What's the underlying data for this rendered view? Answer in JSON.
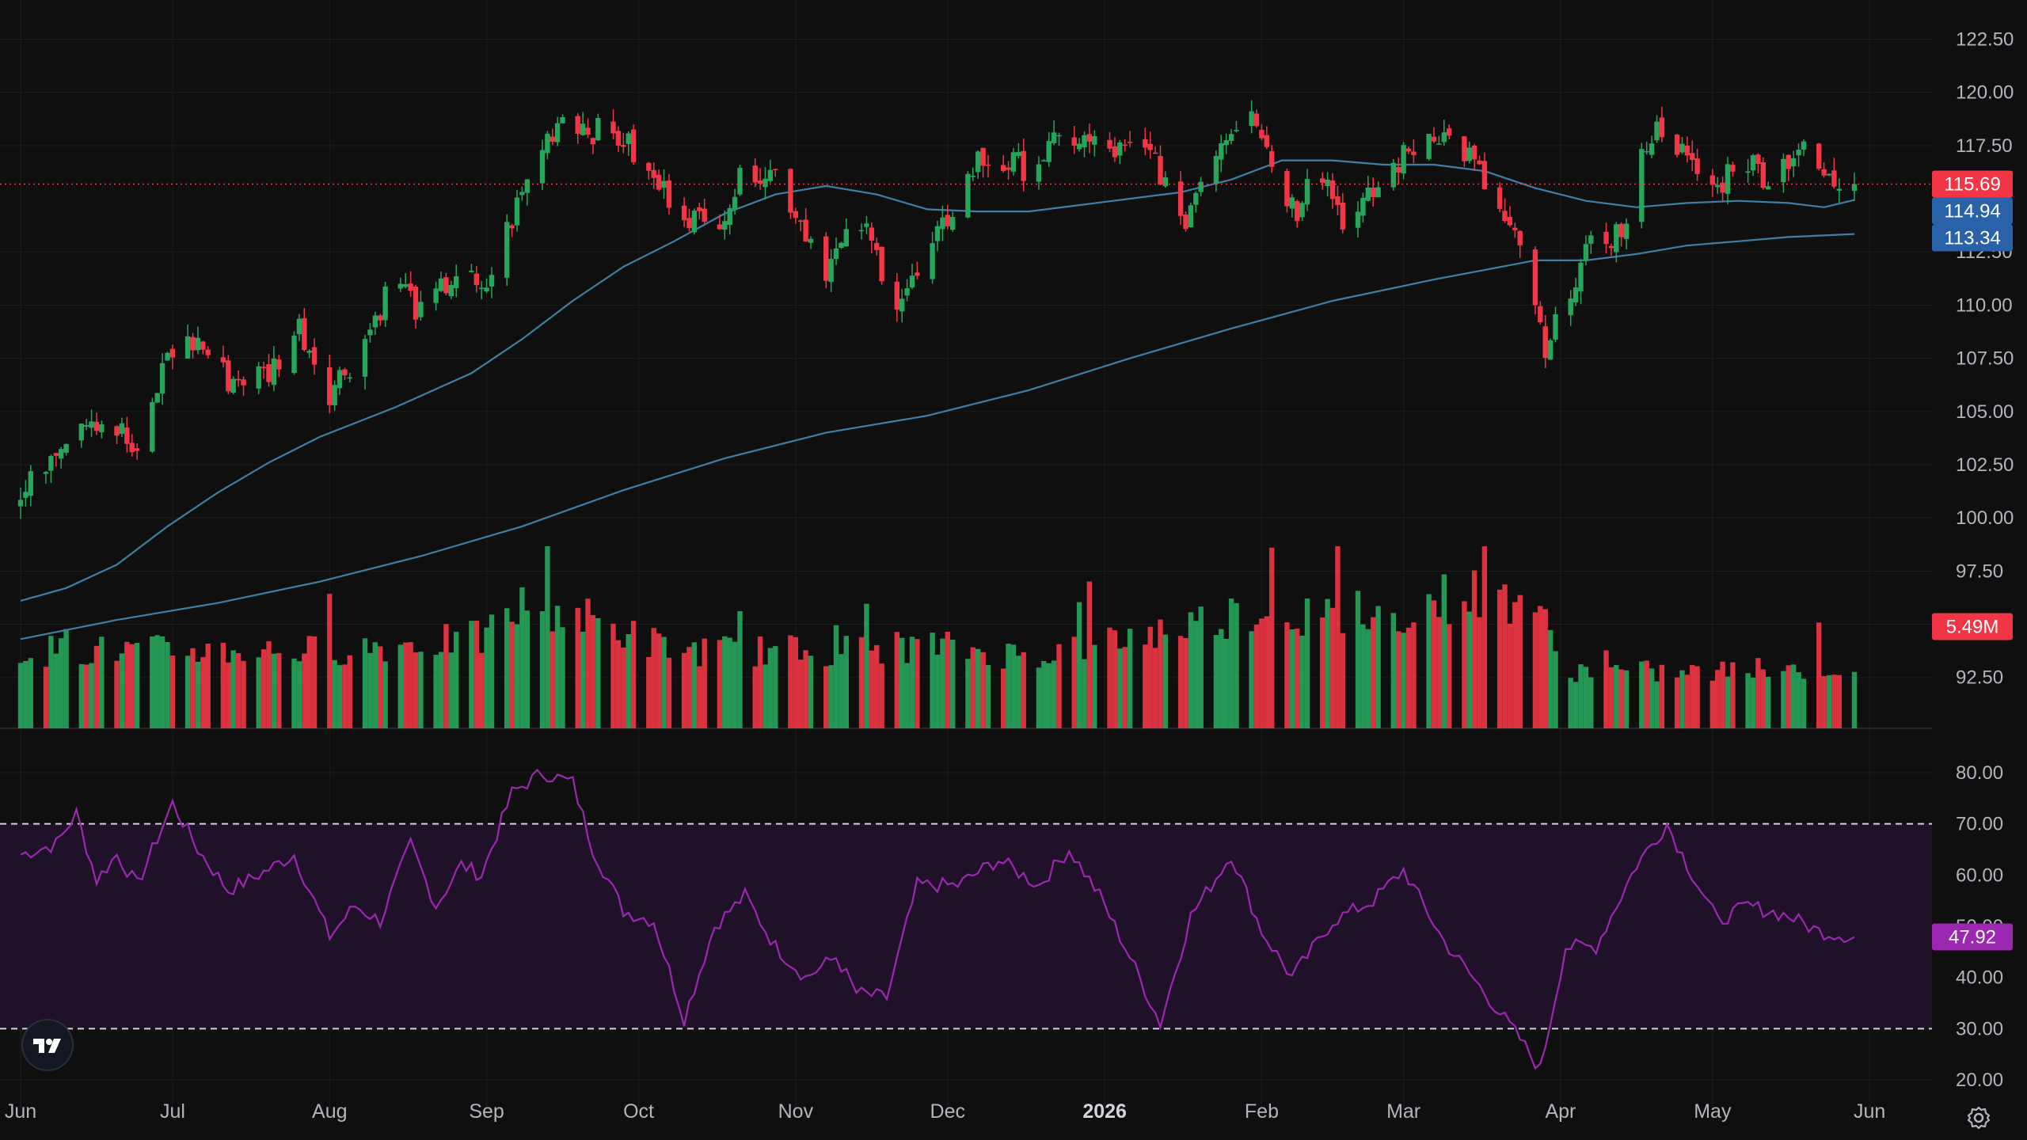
{
  "chart_data": {
    "type": "candlestick",
    "title": "",
    "price_axis": {
      "ticks": [
        "122.50",
        "120.00",
        "117.50",
        "112.50",
        "110.00",
        "107.50",
        "105.00",
        "102.50",
        "100.00",
        "97.50",
        "95.00",
        "92.50"
      ],
      "ylim": [
        91.0,
        123.0
      ]
    },
    "time_axis": {
      "ticks": [
        {
          "label": "Jun",
          "day": 1
        },
        {
          "label": "Jul",
          "day": 31
        },
        {
          "label": "Aug",
          "day": 62
        },
        {
          "label": "Sep",
          "day": 93
        },
        {
          "label": "Oct",
          "day": 123
        },
        {
          "label": "Nov",
          "day": 154
        },
        {
          "label": "Dec",
          "day": 184
        },
        {
          "label": "2026",
          "day": 215,
          "bold": true
        },
        {
          "label": "Feb",
          "day": 246
        },
        {
          "label": "Mar",
          "day": 274
        },
        {
          "label": "Apr",
          "day": 305
        },
        {
          "label": "May",
          "day": 335
        },
        {
          "label": "Jun",
          "day": 366
        }
      ]
    },
    "price_path": [
      {
        "day": 1,
        "close": 100.8
      },
      {
        "day": 8,
        "close": 103.5
      },
      {
        "day": 14,
        "close": 104.9
      },
      {
        "day": 21,
        "close": 104.0
      },
      {
        "day": 24,
        "close": 102.6
      },
      {
        "day": 30,
        "close": 107.8
      },
      {
        "day": 36,
        "close": 108.3
      },
      {
        "day": 42,
        "close": 106.5
      },
      {
        "day": 50,
        "close": 106.8
      },
      {
        "day": 56,
        "close": 109.0
      },
      {
        "day": 62,
        "close": 106.0
      },
      {
        "day": 68,
        "close": 107.9
      },
      {
        "day": 75,
        "close": 111.5
      },
      {
        "day": 80,
        "close": 109.5
      },
      {
        "day": 88,
        "close": 111.8
      },
      {
        "day": 92,
        "close": 110.3
      },
      {
        "day": 97,
        "close": 113.5
      },
      {
        "day": 104,
        "close": 117.5
      },
      {
        "day": 108,
        "close": 119.0
      },
      {
        "day": 116,
        "close": 118.0
      },
      {
        "day": 120,
        "close": 117.8
      },
      {
        "day": 125,
        "close": 116.0
      },
      {
        "day": 132,
        "close": 114.5
      },
      {
        "day": 137,
        "close": 113.5
      },
      {
        "day": 145,
        "close": 116.5
      },
      {
        "day": 150,
        "close": 116.2
      },
      {
        "day": 155,
        "close": 114.0
      },
      {
        "day": 160,
        "close": 111.8
      },
      {
        "day": 167,
        "close": 113.8
      },
      {
        "day": 174,
        "close": 110.3
      },
      {
        "day": 179,
        "close": 111.5
      },
      {
        "day": 185,
        "close": 114.6
      },
      {
        "day": 190,
        "close": 116.8
      },
      {
        "day": 200,
        "close": 116.5
      },
      {
        "day": 208,
        "close": 118.0
      },
      {
        "day": 215,
        "close": 117.3
      },
      {
        "day": 225,
        "close": 117.0
      },
      {
        "day": 230,
        "close": 113.5
      },
      {
        "day": 236,
        "close": 117.2
      },
      {
        "day": 244,
        "close": 119.6
      },
      {
        "day": 249,
        "close": 116.0
      },
      {
        "day": 253,
        "close": 114.4
      },
      {
        "day": 256,
        "close": 117.4
      },
      {
        "day": 263,
        "close": 113.6
      },
      {
        "day": 272,
        "close": 116.5
      },
      {
        "day": 280,
        "close": 118.3
      },
      {
        "day": 287,
        "close": 117.0
      },
      {
        "day": 293,
        "close": 114.3
      },
      {
        "day": 299,
        "close": 111.6
      },
      {
        "day": 302,
        "close": 107.2
      },
      {
        "day": 306,
        "close": 110.6
      },
      {
        "day": 312,
        "close": 113.0
      },
      {
        "day": 318,
        "close": 113.6
      },
      {
        "day": 322,
        "close": 117.8
      },
      {
        "day": 326,
        "close": 118.6
      },
      {
        "day": 330,
        "close": 116.6
      },
      {
        "day": 336,
        "close": 115.4
      },
      {
        "day": 340,
        "close": 117.2
      },
      {
        "day": 346,
        "close": 116.0
      },
      {
        "day": 352,
        "close": 117.4
      },
      {
        "day": 358,
        "close": 115.8
      },
      {
        "day": 363,
        "close": 115.69
      }
    ],
    "moving_averages": [
      {
        "name": "MA short",
        "color": "#3d7fa6",
        "last_label": "114.94",
        "path": [
          {
            "day": 1,
            "value": 96.1
          },
          {
            "day": 10,
            "value": 96.7
          },
          {
            "day": 20,
            "value": 97.8
          },
          {
            "day": 30,
            "value": 99.6
          },
          {
            "day": 40,
            "value": 101.2
          },
          {
            "day": 50,
            "value": 102.6
          },
          {
            "day": 60,
            "value": 103.8
          },
          {
            "day": 75,
            "value": 105.2
          },
          {
            "day": 90,
            "value": 106.8
          },
          {
            "day": 100,
            "value": 108.4
          },
          {
            "day": 110,
            "value": 110.2
          },
          {
            "day": 120,
            "value": 111.8
          },
          {
            "day": 130,
            "value": 113.0
          },
          {
            "day": 140,
            "value": 114.3
          },
          {
            "day": 150,
            "value": 115.2
          },
          {
            "day": 160,
            "value": 115.6
          },
          {
            "day": 170,
            "value": 115.2
          },
          {
            "day": 180,
            "value": 114.5
          },
          {
            "day": 190,
            "value": 114.4
          },
          {
            "day": 200,
            "value": 114.4
          },
          {
            "day": 210,
            "value": 114.7
          },
          {
            "day": 220,
            "value": 115.0
          },
          {
            "day": 230,
            "value": 115.3
          },
          {
            "day": 240,
            "value": 115.9
          },
          {
            "day": 250,
            "value": 116.8
          },
          {
            "day": 260,
            "value": 116.8
          },
          {
            "day": 270,
            "value": 116.6
          },
          {
            "day": 280,
            "value": 116.6
          },
          {
            "day": 290,
            "value": 116.3
          },
          {
            "day": 300,
            "value": 115.5
          },
          {
            "day": 310,
            "value": 114.9
          },
          {
            "day": 320,
            "value": 114.6
          },
          {
            "day": 330,
            "value": 114.8
          },
          {
            "day": 340,
            "value": 114.9
          },
          {
            "day": 350,
            "value": 114.8
          },
          {
            "day": 357,
            "value": 114.6
          },
          {
            "day": 363,
            "value": 114.94
          }
        ]
      },
      {
        "name": "MA long",
        "color": "#3d7fa6",
        "last_label": "113.34",
        "path": [
          {
            "day": 1,
            "value": 94.3
          },
          {
            "day": 20,
            "value": 95.2
          },
          {
            "day": 40,
            "value": 96.0
          },
          {
            "day": 60,
            "value": 97.0
          },
          {
            "day": 80,
            "value": 98.2
          },
          {
            "day": 100,
            "value": 99.6
          },
          {
            "day": 120,
            "value": 101.3
          },
          {
            "day": 140,
            "value": 102.8
          },
          {
            "day": 160,
            "value": 104.0
          },
          {
            "day": 180,
            "value": 104.8
          },
          {
            "day": 200,
            "value": 106.0
          },
          {
            "day": 220,
            "value": 107.5
          },
          {
            "day": 240,
            "value": 108.9
          },
          {
            "day": 260,
            "value": 110.2
          },
          {
            "day": 280,
            "value": 111.2
          },
          {
            "day": 300,
            "value": 112.1
          },
          {
            "day": 310,
            "value": 112.1
          },
          {
            "day": 320,
            "value": 112.4
          },
          {
            "day": 330,
            "value": 112.8
          },
          {
            "day": 340,
            "value": 113.0
          },
          {
            "day": 350,
            "value": 113.2
          },
          {
            "day": 363,
            "value": 113.34
          }
        ]
      }
    ],
    "last_price": {
      "value": 115.69,
      "label": "115.69",
      "color": "#f23645"
    },
    "volume": {
      "last_label": "5.49M",
      "max_relative": 1.0,
      "level_path": [
        {
          "day": 1,
          "level": 0.45
        },
        {
          "day": 30,
          "level": 0.45
        },
        {
          "day": 60,
          "level": 0.45
        },
        {
          "day": 92,
          "level": 0.52
        },
        {
          "day": 102,
          "level": 0.75
        },
        {
          "day": 130,
          "level": 0.45
        },
        {
          "day": 160,
          "level": 0.45
        },
        {
          "day": 180,
          "level": 0.48
        },
        {
          "day": 200,
          "level": 0.42
        },
        {
          "day": 224,
          "level": 0.55
        },
        {
          "day": 246,
          "level": 0.7
        },
        {
          "day": 265,
          "level": 0.6
        },
        {
          "day": 285,
          "level": 0.78
        },
        {
          "day": 300,
          "level": 0.75
        },
        {
          "day": 305,
          "level": 0.34
        },
        {
          "day": 330,
          "level": 0.32
        },
        {
          "day": 363,
          "level": 0.36
        }
      ]
    },
    "rsi": {
      "ticks": [
        "80.00",
        "70.00",
        "60.00",
        "50.00",
        "40.00",
        "30.00",
        "20.00"
      ],
      "ylim": [
        16,
        84
      ],
      "upper_band": 70,
      "lower_band": 30,
      "last_value": 47.92,
      "last_label": "47.92",
      "color": "#9c27b0",
      "path": [
        {
          "day": 1,
          "value": 64
        },
        {
          "day": 8,
          "value": 66
        },
        {
          "day": 12,
          "value": 72
        },
        {
          "day": 16,
          "value": 59
        },
        {
          "day": 20,
          "value": 64
        },
        {
          "day": 24,
          "value": 58
        },
        {
          "day": 31,
          "value": 74
        },
        {
          "day": 36,
          "value": 65
        },
        {
          "day": 42,
          "value": 57
        },
        {
          "day": 48,
          "value": 60
        },
        {
          "day": 55,
          "value": 64
        },
        {
          "day": 62,
          "value": 48
        },
        {
          "day": 67,
          "value": 54
        },
        {
          "day": 72,
          "value": 51
        },
        {
          "day": 78,
          "value": 66
        },
        {
          "day": 83,
          "value": 54
        },
        {
          "day": 88,
          "value": 62
        },
        {
          "day": 92,
          "value": 60
        },
        {
          "day": 98,
          "value": 76
        },
        {
          "day": 104,
          "value": 80
        },
        {
          "day": 110,
          "value": 78
        },
        {
          "day": 114,
          "value": 65
        },
        {
          "day": 120,
          "value": 53
        },
        {
          "day": 126,
          "value": 51
        },
        {
          "day": 132,
          "value": 32
        },
        {
          "day": 138,
          "value": 50
        },
        {
          "day": 144,
          "value": 56
        },
        {
          "day": 150,
          "value": 46
        },
        {
          "day": 156,
          "value": 40
        },
        {
          "day": 162,
          "value": 44
        },
        {
          "day": 166,
          "value": 37
        },
        {
          "day": 172,
          "value": 36
        },
        {
          "day": 178,
          "value": 58
        },
        {
          "day": 186,
          "value": 58
        },
        {
          "day": 194,
          "value": 63
        },
        {
          "day": 202,
          "value": 58
        },
        {
          "day": 208,
          "value": 65
        },
        {
          "day": 214,
          "value": 56
        },
        {
          "day": 220,
          "value": 44
        },
        {
          "day": 226,
          "value": 31
        },
        {
          "day": 232,
          "value": 52
        },
        {
          "day": 240,
          "value": 64
        },
        {
          "day": 246,
          "value": 49
        },
        {
          "day": 252,
          "value": 40
        },
        {
          "day": 260,
          "value": 51
        },
        {
          "day": 268,
          "value": 55
        },
        {
          "day": 274,
          "value": 61
        },
        {
          "day": 282,
          "value": 47
        },
        {
          "day": 290,
          "value": 37
        },
        {
          "day": 297,
          "value": 28
        },
        {
          "day": 301,
          "value": 22
        },
        {
          "day": 306,
          "value": 46
        },
        {
          "day": 312,
          "value": 46
        },
        {
          "day": 320,
          "value": 62
        },
        {
          "day": 326,
          "value": 70
        },
        {
          "day": 330,
          "value": 62
        },
        {
          "day": 336,
          "value": 51
        },
        {
          "day": 342,
          "value": 54
        },
        {
          "day": 350,
          "value": 52
        },
        {
          "day": 356,
          "value": 49
        },
        {
          "day": 363,
          "value": 47.92
        }
      ]
    }
  },
  "logo": {
    "icon": "tradingview-logo-icon",
    "text": "TV"
  },
  "settings": {
    "icon": "gear-icon"
  },
  "colors": {
    "background": "#0f0f0f",
    "up": "#26a65b",
    "down": "#f23645",
    "grid": "#1c1c1c",
    "rsi_fill": "#1e1128"
  }
}
